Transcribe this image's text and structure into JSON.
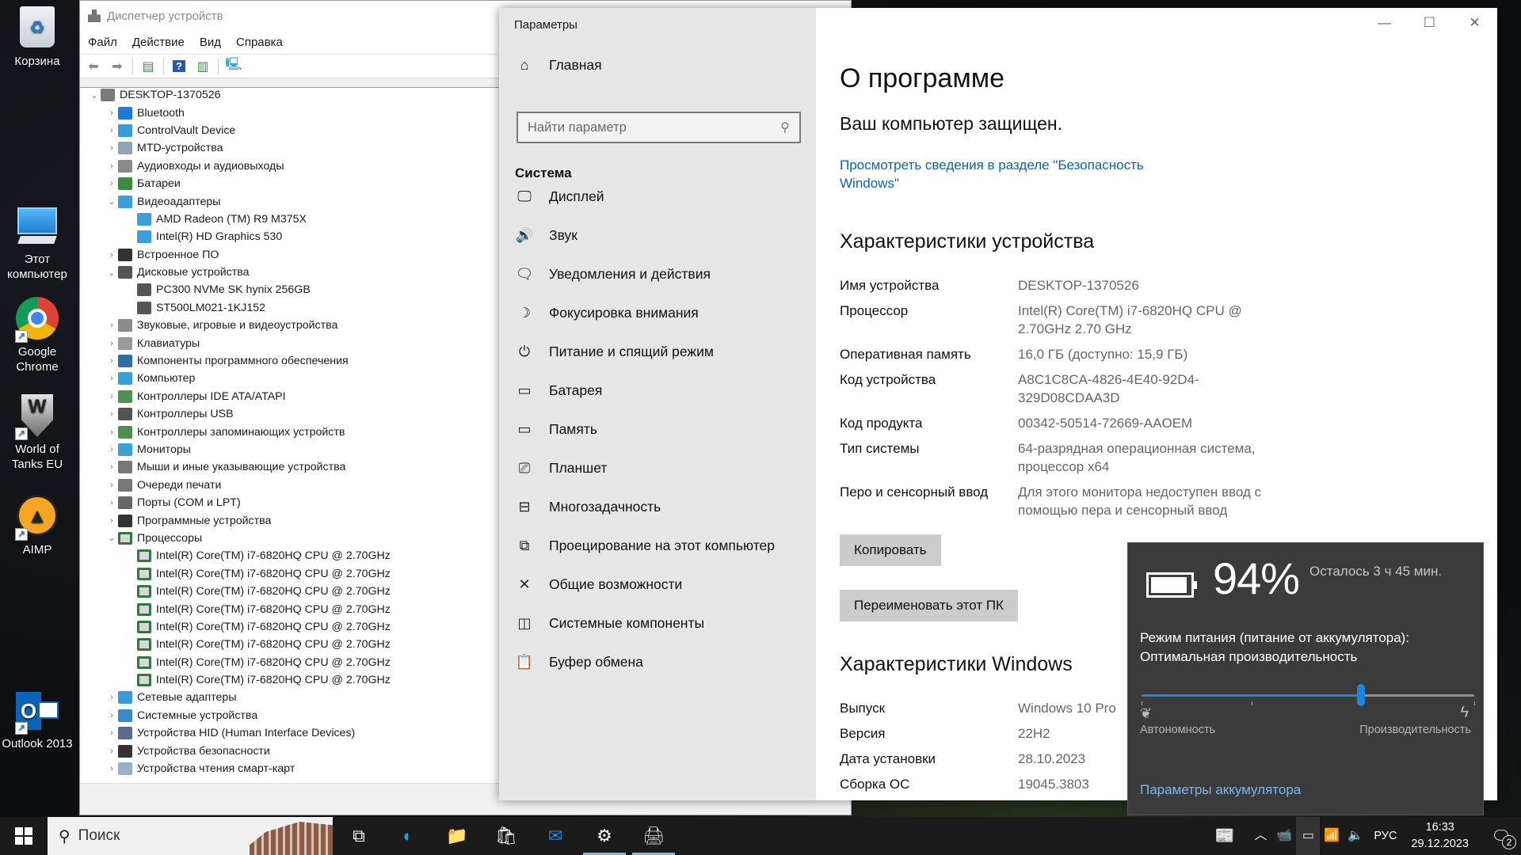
{
  "desktop": {
    "icons": [
      {
        "label": "Корзина",
        "icon": "recycle-bin-icon"
      },
      {
        "label": "Этот компьютер",
        "icon": "this-pc-icon"
      },
      {
        "label": "Google Chrome",
        "icon": "chrome-icon"
      },
      {
        "label": "World of Tanks EU",
        "icon": "world-of-tanks-icon"
      },
      {
        "label": "AIMP",
        "icon": "aimp-icon"
      },
      {
        "label": "Outlook 2013",
        "icon": "outlook-icon"
      }
    ]
  },
  "device_manager": {
    "title": "Диспетчер устройств",
    "menu": [
      "Файл",
      "Действие",
      "Вид",
      "Справка"
    ],
    "toolbar": [
      "back-icon",
      "forward-icon",
      "properties-icon",
      "help-icon",
      "show-hide-console-tree-icon",
      "scan-hardware-icon"
    ],
    "tree": [
      {
        "level": 0,
        "expanded": true,
        "label": "DESKTOP-1370526",
        "icon": "computer-icon",
        "color": "#7a7a7a"
      },
      {
        "level": 1,
        "expanded": false,
        "label": "Bluetooth",
        "icon": "bluetooth-icon",
        "color": "#1e7ad8"
      },
      {
        "level": 1,
        "expanded": false,
        "label": "ControlVault Device",
        "icon": "network-device-icon",
        "color": "#3a9ad9"
      },
      {
        "level": 1,
        "expanded": false,
        "label": "MTD-устройства",
        "icon": "mtd-device-icon",
        "color": "#8fa4b6"
      },
      {
        "level": 1,
        "expanded": false,
        "label": "Аудиовходы и аудиовыходы",
        "icon": "speaker-icon",
        "color": "#8a8a8a"
      },
      {
        "level": 1,
        "expanded": false,
        "label": "Батареи",
        "icon": "battery-device-icon",
        "color": "#3c8a3c"
      },
      {
        "level": 1,
        "expanded": true,
        "label": "Видеоадаптеры",
        "icon": "display-adapter-icon",
        "color": "#3aa0d8"
      },
      {
        "level": 2,
        "label": "AMD Radeon (TM) R9 M375X",
        "icon": "display-adapter-icon",
        "color": "#3aa0d8"
      },
      {
        "level": 2,
        "label": "Intel(R) HD Graphics 530",
        "icon": "display-adapter-icon",
        "color": "#3aa0d8"
      },
      {
        "level": 1,
        "expanded": false,
        "label": "Встроенное ПО",
        "icon": "firmware-chip-icon",
        "color": "#333333"
      },
      {
        "level": 1,
        "expanded": true,
        "label": "Дисковые устройства",
        "icon": "disk-drive-icon",
        "color": "#555555"
      },
      {
        "level": 2,
        "label": "PC300 NVMe SK hynix 256GB",
        "icon": "disk-drive-icon",
        "color": "#555555"
      },
      {
        "level": 2,
        "label": "ST500LM021-1KJ152",
        "icon": "disk-drive-icon",
        "color": "#555555"
      },
      {
        "level": 1,
        "expanded": false,
        "label": "Звуковые, игровые и видеоустройства",
        "icon": "speaker-icon",
        "color": "#8a8a8a"
      },
      {
        "level": 1,
        "expanded": false,
        "label": "Клавиатуры",
        "icon": "keyboard-icon",
        "color": "#9a9a9a"
      },
      {
        "level": 1,
        "expanded": false,
        "label": "Компоненты программного обеспечения",
        "icon": "software-component-icon",
        "color": "#2f6f9f"
      },
      {
        "level": 1,
        "expanded": false,
        "label": "Компьютер",
        "icon": "monitor-icon",
        "color": "#3aa0d8"
      },
      {
        "level": 1,
        "expanded": false,
        "label": "Контроллеры IDE ATA/ATAPI",
        "icon": "ide-controller-icon",
        "color": "#4f8f4f"
      },
      {
        "level": 1,
        "expanded": false,
        "label": "Контроллеры USB",
        "icon": "usb-icon",
        "color": "#555555"
      },
      {
        "level": 1,
        "expanded": false,
        "label": "Контроллеры запоминающих устройств",
        "icon": "storage-controller-icon",
        "color": "#4f8f4f"
      },
      {
        "level": 1,
        "expanded": false,
        "label": "Мониторы",
        "icon": "monitor-icon",
        "color": "#3aa0d8"
      },
      {
        "level": 1,
        "expanded": false,
        "label": "Мыши и иные указывающие устройства",
        "icon": "mouse-icon",
        "color": "#777777"
      },
      {
        "level": 1,
        "expanded": false,
        "label": "Очереди печати",
        "icon": "printer-icon",
        "color": "#777777"
      },
      {
        "level": 1,
        "expanded": false,
        "label": "Порты (COM и LPT)",
        "icon": "port-icon",
        "color": "#666666"
      },
      {
        "level": 1,
        "expanded": false,
        "label": "Программные устройства",
        "icon": "software-device-icon",
        "color": "#333333"
      },
      {
        "level": 1,
        "expanded": true,
        "label": "Процессоры",
        "icon": "processor-icon",
        "color": "#2f7a3a"
      },
      {
        "level": 2,
        "label": "Intel(R) Core(TM) i7-6820HQ CPU @ 2.70GHz",
        "icon": "processor-icon",
        "color": "#2f7a3a"
      },
      {
        "level": 2,
        "label": "Intel(R) Core(TM) i7-6820HQ CPU @ 2.70GHz",
        "icon": "processor-icon",
        "color": "#2f7a3a"
      },
      {
        "level": 2,
        "label": "Intel(R) Core(TM) i7-6820HQ CPU @ 2.70GHz",
        "icon": "processor-icon",
        "color": "#2f7a3a"
      },
      {
        "level": 2,
        "label": "Intel(R) Core(TM) i7-6820HQ CPU @ 2.70GHz",
        "icon": "processor-icon",
        "color": "#2f7a3a"
      },
      {
        "level": 2,
        "label": "Intel(R) Core(TM) i7-6820HQ CPU @ 2.70GHz",
        "icon": "processor-icon",
        "color": "#2f7a3a"
      },
      {
        "level": 2,
        "label": "Intel(R) Core(TM) i7-6820HQ CPU @ 2.70GHz",
        "icon": "processor-icon",
        "color": "#2f7a3a"
      },
      {
        "level": 2,
        "label": "Intel(R) Core(TM) i7-6820HQ CPU @ 2.70GHz",
        "icon": "processor-icon",
        "color": "#2f7a3a"
      },
      {
        "level": 2,
        "label": "Intel(R) Core(TM) i7-6820HQ CPU @ 2.70GHz",
        "icon": "processor-icon",
        "color": "#2f7a3a"
      },
      {
        "level": 1,
        "expanded": false,
        "label": "Сетевые адаптеры",
        "icon": "network-adapter-icon",
        "color": "#3a9ad9"
      },
      {
        "level": 1,
        "expanded": false,
        "label": "Системные устройства",
        "icon": "system-device-icon",
        "color": "#3a8ac9"
      },
      {
        "level": 1,
        "expanded": false,
        "label": "Устройства HID (Human Interface Devices)",
        "icon": "hid-icon",
        "color": "#5a6a8a"
      },
      {
        "level": 1,
        "expanded": false,
        "label": "Устройства безопасности",
        "icon": "security-device-icon",
        "color": "#333333"
      },
      {
        "level": 1,
        "expanded": false,
        "label": "Устройства чтения смарт-карт",
        "icon": "smart-card-reader-icon",
        "color": "#9ab0c8"
      }
    ]
  },
  "settings": {
    "app_title": "Параметры",
    "home_label": "Главная",
    "search_placeholder": "Найти параметр",
    "section": "Система",
    "nav": [
      {
        "label": "Дисплей",
        "icon": "display-icon",
        "glyph": "🖵"
      },
      {
        "label": "Звук",
        "icon": "sound-icon",
        "glyph": "🔊"
      },
      {
        "label": "Уведомления и действия",
        "icon": "notifications-icon",
        "glyph": "🗨"
      },
      {
        "label": "Фокусировка внимания",
        "icon": "focus-assist-moon-icon",
        "glyph": "☽"
      },
      {
        "label": "Питание и спящий режим",
        "icon": "power-icon",
        "glyph": "⏻"
      },
      {
        "label": "Батарея",
        "icon": "battery-icon",
        "glyph": "▭"
      },
      {
        "label": "Память",
        "icon": "storage-icon",
        "glyph": "▭"
      },
      {
        "label": "Планшет",
        "icon": "tablet-mode-icon",
        "glyph": "⎚"
      },
      {
        "label": "Многозадачность",
        "icon": "multitasking-icon",
        "glyph": "⊟"
      },
      {
        "label": "Проецирование на этот компьютер",
        "icon": "projecting-icon",
        "glyph": "⧉"
      },
      {
        "label": "Общие возможности",
        "icon": "shared-experiences-icon",
        "glyph": "✕"
      },
      {
        "label": "Системные компоненты",
        "icon": "system-components-icon",
        "glyph": "◫"
      },
      {
        "label": "Буфер обмена",
        "icon": "clipboard-icon",
        "glyph": "📋"
      }
    ],
    "window_controls": {
      "minimize": "—",
      "maximize": "☐",
      "close": "✕"
    },
    "page_title": "О программе",
    "protected_text": "Ваш компьютер защищен.",
    "security_link": "Просмотреть сведения в разделе \"Безопасность Windows\"",
    "device_specs_title": "Характеристики устройства",
    "device_specs": [
      {
        "key": "Имя устройства",
        "value": "DESKTOP-1370526"
      },
      {
        "key": "Процессор",
        "value": "Intel(R) Core(TM) i7-6820HQ CPU @ 2.70GHz   2.70 GHz"
      },
      {
        "key": "Оперативная память",
        "value": "16,0 ГБ (доступно: 15,9 ГБ)"
      },
      {
        "key": "Код устройства",
        "value": "A8C1C8CA-4826-4E40-92D4-329D08CDAA3D"
      },
      {
        "key": "Код продукта",
        "value": "00342-50514-72669-AAOEM"
      },
      {
        "key": "Тип системы",
        "value": "64-разрядная операционная система, процессор x64"
      },
      {
        "key": "Перо и сенсорный ввод",
        "value": "Для этого монитора недоступен ввод с помощью пера и сенсорный ввод"
      }
    ],
    "copy_button": "Копировать",
    "rename_button": "Переименовать этот ПК",
    "windows_specs_title": "Характеристики Windows",
    "windows_specs": [
      {
        "key": "Выпуск",
        "value": "Windows 10 Pro"
      },
      {
        "key": "Версия",
        "value": "22H2"
      },
      {
        "key": "Дата установки",
        "value": "28.10.2023"
      },
      {
        "key": "Сборка ОС",
        "value": "19045.3803"
      }
    ]
  },
  "battery_flyout": {
    "percent_label": "94%",
    "percent": 94,
    "remaining": "Осталось 3 ч 45 мин.",
    "mode_label": "Режим питания (питание от аккумулятора): Оптимальная производительность",
    "slider_position_fraction": 0.66,
    "slider_ticks_fraction": [
      0,
      0.33,
      1
    ],
    "left_label": "Автономность",
    "right_label": "Производительность",
    "settings_link": "Параметры аккумулятора",
    "accent": "#1a86e0"
  },
  "taskbar": {
    "search_placeholder": "Поиск",
    "apps": [
      {
        "name": "task-view",
        "glyph": "⧉",
        "active": false
      },
      {
        "name": "edge",
        "glyph": "◐",
        "active": false
      },
      {
        "name": "file-explorer",
        "glyph": "📁",
        "active": false
      },
      {
        "name": "microsoft-store",
        "glyph": "🛍",
        "active": false
      },
      {
        "name": "mail",
        "glyph": "✉",
        "active": false
      },
      {
        "name": "settings",
        "glyph": "⚙",
        "active": true
      },
      {
        "name": "device-manager",
        "glyph": "🖨",
        "active": true
      }
    ],
    "language": "РУС",
    "time": "16:33",
    "date": "29.12.2023",
    "notification_count": "2"
  }
}
